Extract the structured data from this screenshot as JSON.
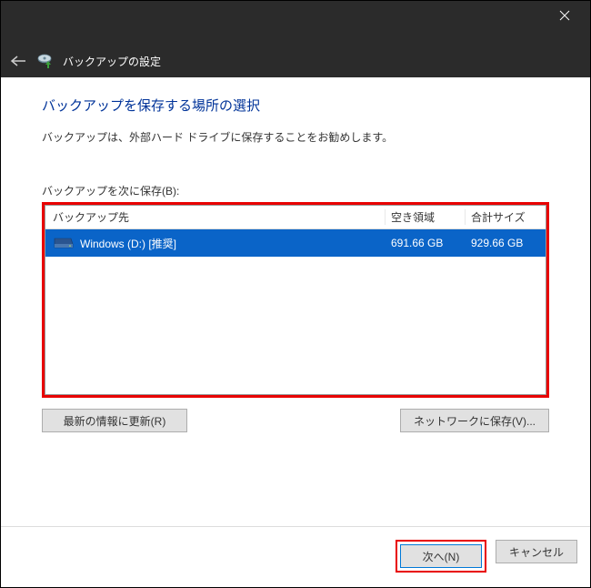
{
  "window": {
    "title": "バックアップの設定"
  },
  "page": {
    "heading": "バックアップを保存する場所の選択",
    "subtitle": "バックアップは、外部ハード ドライブに保存することをお勧めします。",
    "list_label": "バックアップを次に保存(B):"
  },
  "columns": {
    "destination": "バックアップ先",
    "free": "空き領域",
    "total": "合計サイズ"
  },
  "drives": [
    {
      "name": "Windows (D:) [推奨]",
      "free": "691.66 GB",
      "total": "929.66 GB",
      "selected": true
    }
  ],
  "buttons": {
    "refresh": "最新の情報に更新(R)",
    "network": "ネットワークに保存(V)...",
    "next": "次へ(N)",
    "cancel": "キャンセル"
  }
}
